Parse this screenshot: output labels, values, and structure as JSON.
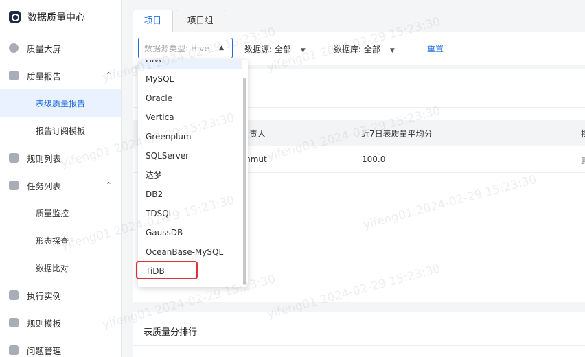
{
  "sidebar": {
    "brand": "数据质量中心",
    "items": [
      {
        "label": "质量大屏",
        "icon": "pie-chart-icon"
      },
      {
        "label": "质量报告",
        "icon": "chart-icon",
        "arrow": "^"
      },
      {
        "label": "表级质量报告",
        "sub": true,
        "active": true
      },
      {
        "label": "报告订阅模板",
        "sub": true
      },
      {
        "label": "规则列表",
        "icon": "list-icon"
      },
      {
        "label": "任务列表",
        "icon": "task-icon",
        "arrow": "^"
      },
      {
        "label": "质量监控",
        "sub": true
      },
      {
        "label": "形态探查",
        "sub": true
      },
      {
        "label": "数据比对",
        "sub": true
      },
      {
        "label": "执行实例",
        "icon": "instance-icon"
      },
      {
        "label": "规则模板",
        "icon": "template-icon"
      },
      {
        "label": "问题管理",
        "icon": "issue-icon"
      }
    ]
  },
  "tabs": [
    {
      "label": "项目",
      "active": true
    },
    {
      "label": "项目组",
      "active": false
    }
  ],
  "filters": {
    "datasource_type_placeholder": "数据源类型: Hive",
    "datasource_label": "数据源: 全部",
    "database_label": "数据库: 全部",
    "reset": "重置"
  },
  "table": {
    "columns": [
      "负责人",
      "近7日表质量平均分",
      "操"
    ],
    "rows": [
      {
        "owner": "mmut",
        "score": "100.0",
        "op": "复"
      }
    ]
  },
  "ranking_title": "表质量分排行",
  "dropdown": {
    "options": [
      "Hive",
      "MySQL",
      "Oracle",
      "Vertica",
      "Greenplum",
      "SQLServer",
      "达梦",
      "DB2",
      "TDSQL",
      "GaussDB",
      "OceanBase-MySQL",
      "TiDB"
    ],
    "highlighted": "TiDB",
    "highlight_color": "#e0303a"
  },
  "watermark": {
    "text_full": "yifeng01 2024-02-29 15:23:30"
  },
  "colors": {
    "accent": "#1f6fe0",
    "sidebar_active_bg": "#eaf2ff"
  }
}
